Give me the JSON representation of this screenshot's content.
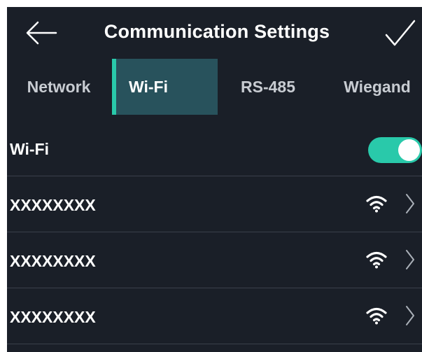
{
  "header": {
    "title": "Communication Settings",
    "back_icon": "arrow-left-icon",
    "confirm_icon": "checkmark-icon"
  },
  "tabs": [
    {
      "label": "Network",
      "active": false
    },
    {
      "label": "Wi-Fi",
      "active": true
    },
    {
      "label": "RS-485",
      "active": false
    },
    {
      "label": "Wiegand",
      "active": false
    }
  ],
  "wifi_toggle": {
    "label": "Wi-Fi",
    "enabled": true
  },
  "networks": [
    {
      "name": "XXXXXXXX",
      "signal_icon": "wifi-signal-icon"
    },
    {
      "name": "XXXXXXXX",
      "signal_icon": "wifi-signal-icon"
    },
    {
      "name": "XXXXXXXX",
      "signal_icon": "wifi-signal-icon"
    }
  ],
  "colors": {
    "background": "#1a1f28",
    "accent": "#29c9aa",
    "active_tab": "#28525c",
    "divider": "#3a404b",
    "text": "#ffffff"
  }
}
